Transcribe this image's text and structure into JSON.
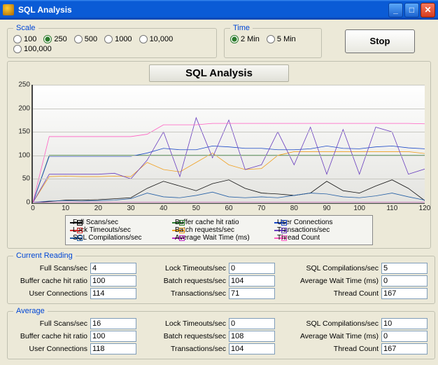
{
  "window": {
    "title": "SQL Analysis"
  },
  "scale": {
    "legend": "Scale",
    "options": [
      "100",
      "250",
      "500",
      "1000",
      "10,000",
      "100,000"
    ],
    "selected": "250"
  },
  "time": {
    "legend": "Time",
    "options": [
      "2 Min",
      "5 Min"
    ],
    "selected": "2 Min"
  },
  "stop_label": "Stop",
  "chart": {
    "title": "SQL Analysis"
  },
  "legend_items": [
    "Full Scans/sec",
    "Buffer cache hit ratio",
    "User Connections",
    "Lock Timeouts/sec",
    "Batch requests/sec",
    "Transactions/sec",
    "SQL Compilations/sec",
    "Average Wait Time (ms)",
    "Thread Count"
  ],
  "current": {
    "legend": "Current Reading",
    "full_scans": "4",
    "buffer_cache": "100",
    "user_conn": "114",
    "lock_timeouts": "0",
    "batch_requests": "104",
    "transactions": "71",
    "sql_compilations": "5",
    "avg_wait": "0",
    "thread_count": "167"
  },
  "average": {
    "legend": "Average",
    "full_scans": "16",
    "buffer_cache": "100",
    "user_conn": "118",
    "lock_timeouts": "0",
    "batch_requests": "108",
    "transactions": "104",
    "sql_compilations": "10",
    "avg_wait": "0",
    "thread_count": "167"
  },
  "labels": {
    "full_scans": "Full Scans/sec",
    "buffer_cache": "Buffer cache hit ratio",
    "user_conn": "User Connections",
    "lock_timeouts": "Lock Timeouts/sec",
    "batch_requests": "Batch requests/sec",
    "transactions": "Transactions/sec",
    "sql_compilations": "SQL Compilations/sec",
    "avg_wait": "Average Wait Time (ms)",
    "thread_count": "Thread Count"
  },
  "chart_data": {
    "type": "line",
    "xlabel": "",
    "ylabel": "",
    "xlim": [
      0,
      120
    ],
    "ylim": [
      0,
      250
    ],
    "x_ticks": [
      0,
      10,
      20,
      30,
      40,
      50,
      60,
      70,
      80,
      90,
      100,
      110,
      120
    ],
    "y_ticks": [
      0,
      50,
      100,
      150,
      200,
      250
    ],
    "x": [
      0,
      5,
      10,
      15,
      20,
      25,
      30,
      35,
      40,
      45,
      50,
      55,
      60,
      65,
      70,
      75,
      80,
      85,
      90,
      95,
      100,
      105,
      110,
      115,
      120
    ],
    "series": [
      {
        "name": "Full Scans/sec",
        "color": "#111111",
        "marker": "square",
        "values": [
          0,
          2,
          5,
          5,
          6,
          8,
          10,
          30,
          45,
          35,
          25,
          40,
          48,
          30,
          20,
          18,
          15,
          20,
          45,
          25,
          20,
          35,
          48,
          30,
          4
        ]
      },
      {
        "name": "Buffer cache hit ratio",
        "color": "#2e7d32",
        "marker": "circle",
        "values": [
          0,
          100,
          100,
          100,
          100,
          100,
          100,
          100,
          100,
          100,
          100,
          100,
          100,
          100,
          100,
          100,
          100,
          100,
          100,
          100,
          100,
          100,
          100,
          100,
          100
        ]
      },
      {
        "name": "User Connections",
        "color": "#1a48c8",
        "marker": "diamond",
        "values": [
          0,
          98,
          98,
          98,
          98,
          98,
          98,
          105,
          115,
          112,
          112,
          120,
          118,
          115,
          115,
          112,
          112,
          114,
          120,
          115,
          114,
          118,
          120,
          116,
          114
        ]
      },
      {
        "name": "Lock Timeouts/sec",
        "color": "#d62f2f",
        "marker": "plus",
        "values": [
          0,
          0,
          0,
          0,
          0,
          0,
          0,
          0,
          0,
          0,
          0,
          0,
          0,
          0,
          0,
          0,
          0,
          0,
          0,
          0,
          0,
          0,
          0,
          0,
          0
        ]
      },
      {
        "name": "Batch requests/sec",
        "color": "#f0a020",
        "marker": "circle",
        "values": [
          0,
          55,
          56,
          55,
          55,
          56,
          55,
          85,
          70,
          65,
          85,
          105,
          80,
          70,
          72,
          100,
          108,
          108,
          108,
          108,
          108,
          108,
          108,
          108,
          104
        ]
      },
      {
        "name": "Transactions/sec",
        "color": "#6a3fbf",
        "marker": "x",
        "values": [
          0,
          60,
          60,
          60,
          60,
          62,
          50,
          90,
          150,
          55,
          180,
          95,
          175,
          70,
          80,
          150,
          80,
          160,
          60,
          155,
          60,
          160,
          150,
          60,
          71
        ]
      },
      {
        "name": "SQL Compilations/sec",
        "color": "#245fa5",
        "marker": "diamond",
        "values": [
          0,
          3,
          4,
          3,
          4,
          5,
          8,
          20,
          12,
          10,
          15,
          22,
          12,
          10,
          12,
          10,
          15,
          20,
          18,
          12,
          10,
          14,
          20,
          12,
          5
        ]
      },
      {
        "name": "Average Wait Time (ms)",
        "color": "#c030c8",
        "marker": "triangle",
        "values": [
          0,
          0,
          0,
          0,
          0,
          0,
          0,
          0,
          0,
          0,
          0,
          0,
          0,
          0,
          0,
          0,
          0,
          0,
          0,
          0,
          0,
          0,
          0,
          0,
          0
        ]
      },
      {
        "name": "Thread Count",
        "color": "#ff5ec2",
        "marker": "circle",
        "values": [
          0,
          140,
          140,
          140,
          140,
          140,
          140,
          145,
          165,
          165,
          165,
          168,
          168,
          168,
          168,
          168,
          168,
          168,
          168,
          168,
          168,
          168,
          168,
          168,
          167
        ]
      }
    ],
    "legend_markers": [
      "square",
      "circle",
      "diamond",
      "plus",
      "circle",
      "x",
      "diamond",
      "triangle",
      "circle"
    ],
    "legend_colors": [
      "#111111",
      "#2e7d32",
      "#1a48c8",
      "#d62f2f",
      "#f0a020",
      "#6a3fbf",
      "#245fa5",
      "#c030c8",
      "#ff5ec2"
    ]
  }
}
